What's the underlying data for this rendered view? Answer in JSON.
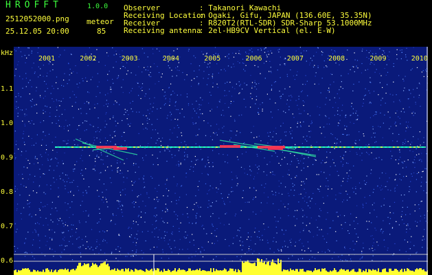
{
  "header": {
    "app_name": "HROFFT",
    "version": "1.0.0",
    "filename": "2512052000.png",
    "datetime": "25.12.05 20:00",
    "meteor_label": "meteor",
    "meteor_count": "85",
    "info": [
      {
        "key": "Observer",
        "value": ": Takanori Kawachi"
      },
      {
        "key": "Receiving Location",
        "value": ": Ogaki, Gifu, JAPAN (136.60E, 35.35N)"
      },
      {
        "key": "Receiver",
        "value": ": R820T2(RTL-SDR) SDR-Sharp 53.1000MHz"
      },
      {
        "key": "Receiving antenna",
        "value": ": 2el-HB9CV Vertical (el. E-W)"
      }
    ]
  },
  "chart_data": {
    "type": "heatmap",
    "ylabel": "kHz",
    "y_ticks": [
      "1.1",
      "1.0",
      "0.9",
      "0.8",
      "0.7",
      "0.6"
    ],
    "x_ticks": [
      "2001",
      "2002",
      "2003",
      "2004",
      "2005",
      "2006",
      "2007",
      "2008",
      "2009",
      "2010"
    ],
    "colors": {
      "background": "#0a1a7a",
      "text": "#ffff3c",
      "title": "#3cff3c",
      "carrier": "#30e0a0",
      "echo": "#ff3050",
      "histogram": "#ffff30"
    }
  }
}
